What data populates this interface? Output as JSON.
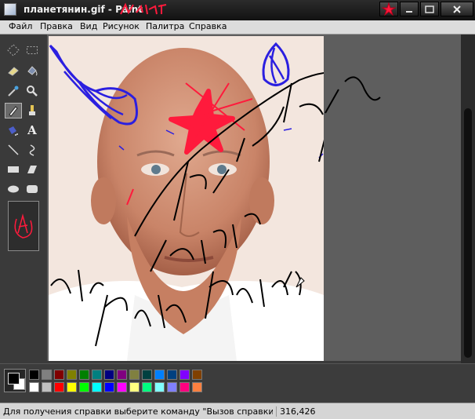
{
  "window": {
    "title": "планетянин.gif - Paint",
    "title_scribble": "нихе"
  },
  "menu": [
    "Файл",
    "Правка",
    "Вид",
    "Рисунок",
    "Палитра",
    "Справка"
  ],
  "tools": [
    {
      "name": "free-select-icon"
    },
    {
      "name": "rect-select-icon"
    },
    {
      "name": "eraser-icon"
    },
    {
      "name": "fill-icon"
    },
    {
      "name": "color-picker-icon"
    },
    {
      "name": "magnifier-icon"
    },
    {
      "name": "pencil-icon",
      "selected": true
    },
    {
      "name": "brush-icon"
    },
    {
      "name": "airbrush-icon"
    },
    {
      "name": "text-icon",
      "glyph": "A"
    },
    {
      "name": "line-icon"
    },
    {
      "name": "curve-icon"
    },
    {
      "name": "rectangle-icon"
    },
    {
      "name": "polygon-icon"
    },
    {
      "name": "ellipse-icon"
    },
    {
      "name": "rounded-rect-icon"
    }
  ],
  "canvas": {
    "scribbles": [
      "Paint",
      "Paint",
      "Paint",
      "Paint",
      "Paint",
      "Paint"
    ]
  },
  "palette": {
    "foreground": "#000000",
    "background": "#ffffff",
    "colors": [
      "#000000",
      "#808080",
      "#800000",
      "#808000",
      "#008000",
      "#008080",
      "#000080",
      "#800080",
      "#808040",
      "#004040",
      "#0080ff",
      "#004080",
      "#8000ff",
      "#804000",
      "#ffffff",
      "#c0c0c0",
      "#ff0000",
      "#ffff00",
      "#00ff00",
      "#00ffff",
      "#0000ff",
      "#ff00ff",
      "#ffff80",
      "#00ff80",
      "#80ffff",
      "#8080ff",
      "#ff0080",
      "#ff8040"
    ]
  },
  "status": {
    "help_text": "Для получения справки выберите команду \"Вызов справки\" из меню",
    "coords": "316,426"
  }
}
